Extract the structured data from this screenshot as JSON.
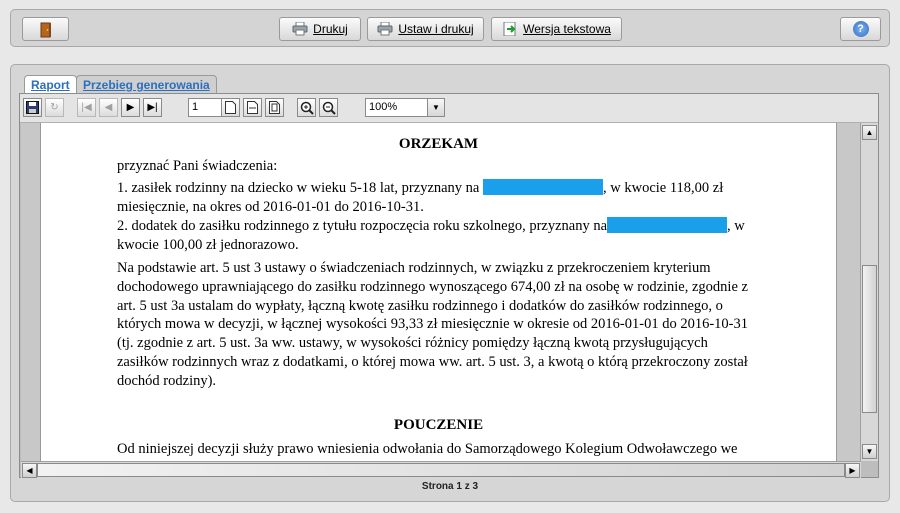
{
  "toolbar": {
    "print_label": "Drukuj",
    "setup_print_label": "Ustaw i drukuj",
    "text_version_label": "Wersja tekstowa",
    "help_label": "?"
  },
  "tabs": [
    {
      "label": "Raport"
    },
    {
      "label": "Przebieg generowania"
    }
  ],
  "viewer": {
    "page_value": "1",
    "zoom": "100%",
    "status": "Strona 1 z 3"
  },
  "document": {
    "heading1": "ORZEKAM",
    "line_intro": "przyznać Pani świadczenia:",
    "item1_a": "1. zasiłek rodzinny na dziecko w wieku 5-18 lat, przyznany na",
    "item1_b": ", w kwocie 118,00 zł",
    "item1_c": "miesięcznie, na okres od 2016-01-01 do 2016-10-31.",
    "item2_a": "2. dodatek do zasiłku rodzinnego z tytułu rozpoczęcia roku szkolnego, przyznany na",
    "item2_b": ", w",
    "item2_c": "kwocie 100,00 zł jednorazowo.",
    "para": [
      "Na podstawie art. 5 ust 3 ustawy o świadczeniach rodzinnych, w związku z przekroczeniem kryterium",
      "dochodowego uprawniającego do zasiłku rodzinnego wynoszącego 674,00 zł na osobę w rodzinie, zgodnie z",
      "art. 5 ust 3a ustalam do wypłaty, łączną kwotę zasiłku rodzinnego i dodatków do zasiłków rodzinnego, o",
      "których mowa w decyzji, w łącznej wysokości 93,33 zł miesięcznie w okresie od 2016-01-01 do 2016-10-31",
      "(tj. zgodnie z art. 5 ust. 3a ww. ustawy, w wysokości różnicy pomiędzy łączną kwotą przysługujących",
      "zasiłków rodzinnych wraz z dodatkami, o której mowa ww. art. 5 ust. 3, a kwotą o którą przekroczony został",
      "dochód rodziny)."
    ],
    "heading2": "POUCZENIE",
    "pouczenie_line": "Od niniejszej decyzji służy prawo wniesienia odwołania do Samorządowego Kolegium Odwoławczego we"
  },
  "colors": {
    "redaction": "#1aa0ea",
    "tab_text": "#2b6fbd"
  }
}
